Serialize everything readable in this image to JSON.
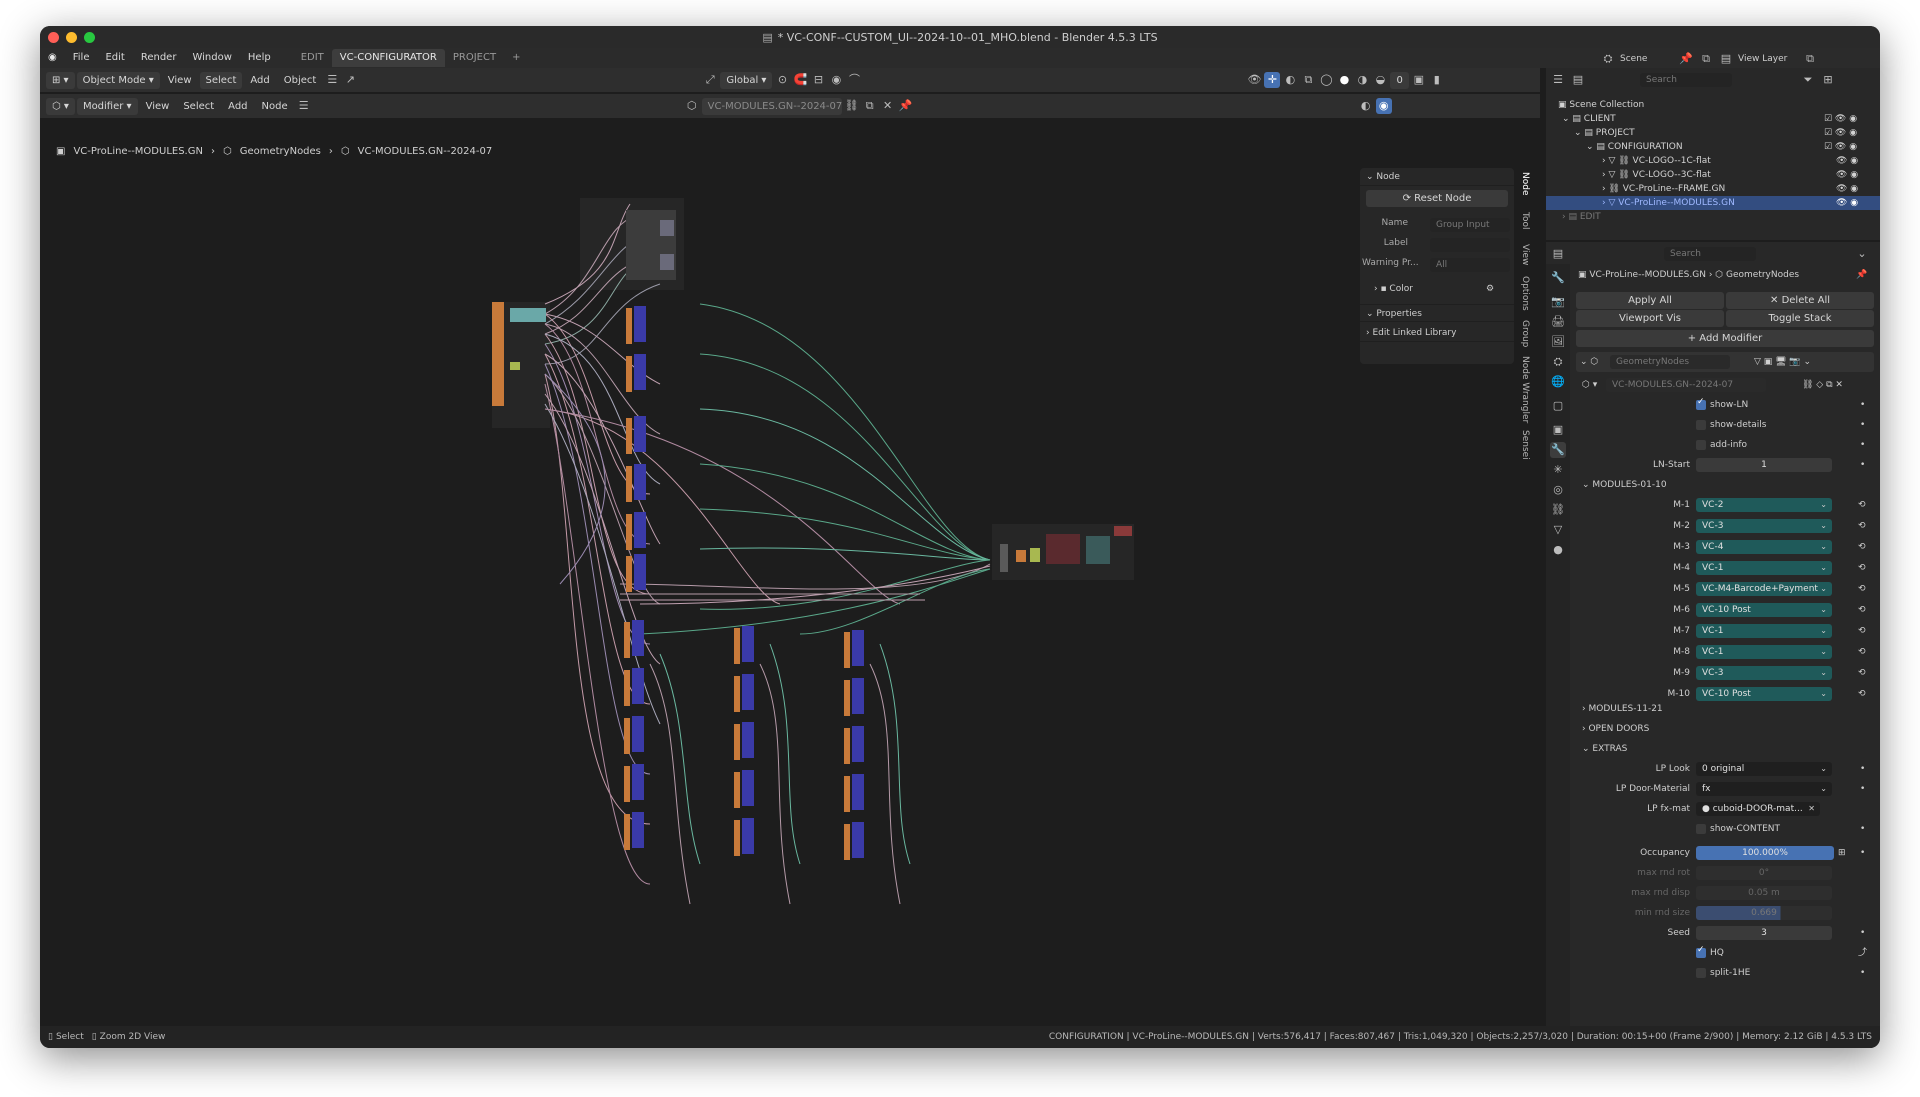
{
  "window": {
    "title": "* VC-CONF--CUSTOM_UI--2024-10--01_MHO.blend - Blender 4.5.3 LTS"
  },
  "menu": {
    "items": [
      "File",
      "Edit",
      "Render",
      "Window",
      "Help"
    ],
    "workspaces": [
      "EDIT",
      "VC-CONFIGURATOR",
      "PROJECT"
    ],
    "add_tab": "+"
  },
  "viewport_header": {
    "mode": "Object Mode",
    "view": "View",
    "select": "Select",
    "add": "Add",
    "object": "Object",
    "orientation": "Global",
    "counter": "0"
  },
  "node_header": {
    "editor_type": "Modifier",
    "view": "View",
    "select": "Select",
    "add": "Add",
    "node": "Node",
    "tree_name": "VC-MODULES.GN--2024-07"
  },
  "breadcrumb": {
    "a": "VC-ProLine--MODULES.GN",
    "b": "GeometryNodes",
    "c": "VC-MODULES.GN--2024-07"
  },
  "npanel": {
    "node_section": "Node",
    "reset": "Reset Node",
    "name_label": "Name",
    "name_value": "Group Input",
    "label_label": "Label",
    "label_value": "",
    "warning_label": "Warning Pr...",
    "warning_value": "All",
    "color_label": "Color",
    "properties": "Properties",
    "edit_linked": "Edit Linked Library"
  },
  "side_tabs": [
    "Node",
    "Tool",
    "View",
    "Options",
    "Group",
    "Node Wrangler",
    "Sensei"
  ],
  "topright": {
    "scene": "Scene",
    "view_layer": "View Layer"
  },
  "outliner": {
    "search": "Search",
    "root": "Scene Collection",
    "rows": [
      "CLIENT",
      "PROJECT",
      "CONFIGURATION",
      "VC-LOGO--1C-flat",
      "VC-LOGO--3C-flat",
      "VC-ProLine--FRAME.GN",
      "VC-ProLine--MODULES.GN",
      "EDIT"
    ]
  },
  "properties": {
    "search": "Search",
    "object": "VC-ProLine--MODULES.GN",
    "modifier_crumb": "GeometryNodes",
    "apply_all": "Apply All",
    "delete_all": "Delete All",
    "viewport_vis": "Viewport Vis",
    "toggle_stack": "Toggle Stack",
    "add_modifier": "Add Modifier",
    "modifier_name": "GeometryNodes",
    "node_group": "VC-MODULES.GN--2024-07",
    "show_ln": "show-LN",
    "show_details": "show-details",
    "add_info": "add-info",
    "ln_start_label": "LN-Start",
    "ln_start": "1",
    "panel_modules": "MODULES-01-10",
    "modules": [
      {
        "label": "M-1",
        "value": "VC-2"
      },
      {
        "label": "M-2",
        "value": "VC-3"
      },
      {
        "label": "M-3",
        "value": "VC-4"
      },
      {
        "label": "M-4",
        "value": "VC-1"
      },
      {
        "label": "M-5",
        "value": "VC-M4-Barcode+Payment"
      },
      {
        "label": "M-6",
        "value": "VC-10 Post"
      },
      {
        "label": "M-7",
        "value": "VC-1"
      },
      {
        "label": "M-8",
        "value": "VC-1"
      },
      {
        "label": "M-9",
        "value": "VC-3"
      },
      {
        "label": "M-10",
        "value": "VC-10 Post"
      }
    ],
    "panel_modules2": "MODULES-11-21",
    "panel_doors": "OPEN DOORS",
    "panel_extras": "EXTRAS",
    "lp_look_label": "LP Look",
    "lp_look": "0 original",
    "lp_door_label": "LP Door-Material",
    "lp_door": "fx",
    "lp_fx_label": "LP fx-mat",
    "lp_fx": "cuboid-DOOR-mat...",
    "show_content": "show-CONTENT",
    "occupancy_label": "Occupancy",
    "occupancy": "100.000%",
    "max_rot_label": "max rnd rot",
    "max_rot": "0°",
    "max_disp_label": "max rnd disp",
    "max_disp": "0.05 m",
    "min_size_label": "min rnd size",
    "min_size": "0.669",
    "seed_label": "Seed",
    "seed": "3",
    "hq": "HQ",
    "split": "split-1HE"
  },
  "status": {
    "select": "Select",
    "zoom": "Zoom 2D View",
    "info": "CONFIGURATION | VC-ProLine--MODULES.GN | Verts:576,417 | Faces:807,467 | Tris:1,049,320 | Objects:2,257/3,020 | Duration: 00:15+00 (Frame 2/900) | Memory: 2.12 GiB | 4.5.3 LTS"
  },
  "colors": {
    "accent": "#4772b3",
    "teal": "#1f5a5a",
    "node_orange": "#c87a3a",
    "node_blue": "#3a3aa8"
  }
}
